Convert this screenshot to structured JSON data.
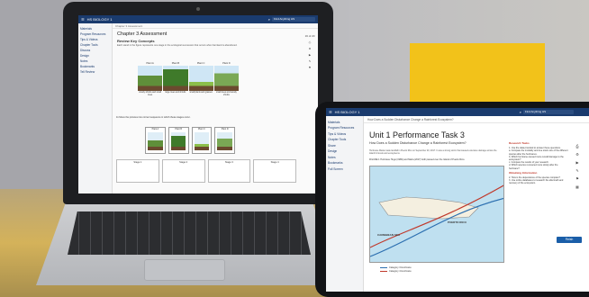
{
  "laptop": {
    "app_name": "HS BIOLOGY 1",
    "search_placeholder": "Find Anything HS",
    "sidebar": [
      "Materials",
      "Program Resources",
      "Tips & Videos",
      "Chapter Tools",
      "Discuss",
      "Design",
      "Notes",
      "Bookmarks",
      "Tell Review"
    ],
    "breadcrumb": "Chapter 3 Assessment",
    "title": "Chapter 3 Assessment",
    "section": "Review Key Concepts",
    "instruction": "Each stand in the figure represents one stage in the ecological succession that occurs when farmland is abandoned.",
    "plants": [
      {
        "label": "Plant A",
        "caption": "woody shrubs and small trees"
      },
      {
        "label": "Plant B",
        "caption": "large trees and shrubs"
      },
      {
        "label": "Plant C",
        "caption": "small plants and grasses"
      },
      {
        "label": "Plant D",
        "caption": "small trees and woody shrubs"
      }
    ],
    "question": "11  Move the pictures into correct sequence in which these stages occur.",
    "sort_cards": [
      "Plant A",
      "Plant B",
      "Plant C",
      "Plant D"
    ],
    "stages": [
      "Stage 1",
      "Stage 2",
      "Stage 3",
      "Stage 4"
    ],
    "page_counter": "16 of 20"
  },
  "tablet": {
    "app_name": "HS BIOLOGY 1",
    "search_placeholder": "Find Anything HS",
    "sidebar": [
      "Materials",
      "Program Resources",
      "Tips & Videos",
      "Chapter Tools",
      "Share",
      "Design",
      "Notes",
      "Bookmarks",
      "Full Screen"
    ],
    "breadcrumb": "How Does a Sudden Disturbance Change a Rainforest Ecosystem?",
    "title": "Unit 1 Performance Task 3",
    "subtitle": "How Does a Sudden Disturbance Change a Rainforest Ecosystem?",
    "body": "Hurricane Maria made landfall in Puerto Rico on September 20, 2017. It was a strong storm that caused extensive damage across the island's forests and ecosystems.",
    "figure_caption": "FIGURE 1  Hurricane Hugo (1989) and Maria (2017) both passed over the Island of Puerto Rico.",
    "map_labels": {
      "sea": "CARIBBEAN SEA",
      "island": "PUERTO RICO"
    },
    "legend": [
      "Category 3 Hurricane",
      "Category 4 Hurricane"
    ],
    "right_heading_1": "Research Tasks",
    "right_text_1": "1. Use the data provided to answer these questions.",
    "right_text_2": "a. Compare the mortality and tree stock size of the different species after the hurricanes.",
    "right_text_3": "b. Which hurricane caused more overall damage to the ecosystem?",
    "right_text_4": "c. Compare the results of your research.",
    "right_text_5": "d. Which species recovered more slowly after the hurricane?",
    "right_heading_2": "Obtaining Information",
    "right_text_6": "2. How is the dependence of the species compare?",
    "right_text_7": "3. Use online databases to research the aftermath and recovery of the ecosystem.",
    "finish_button": "Finish"
  }
}
